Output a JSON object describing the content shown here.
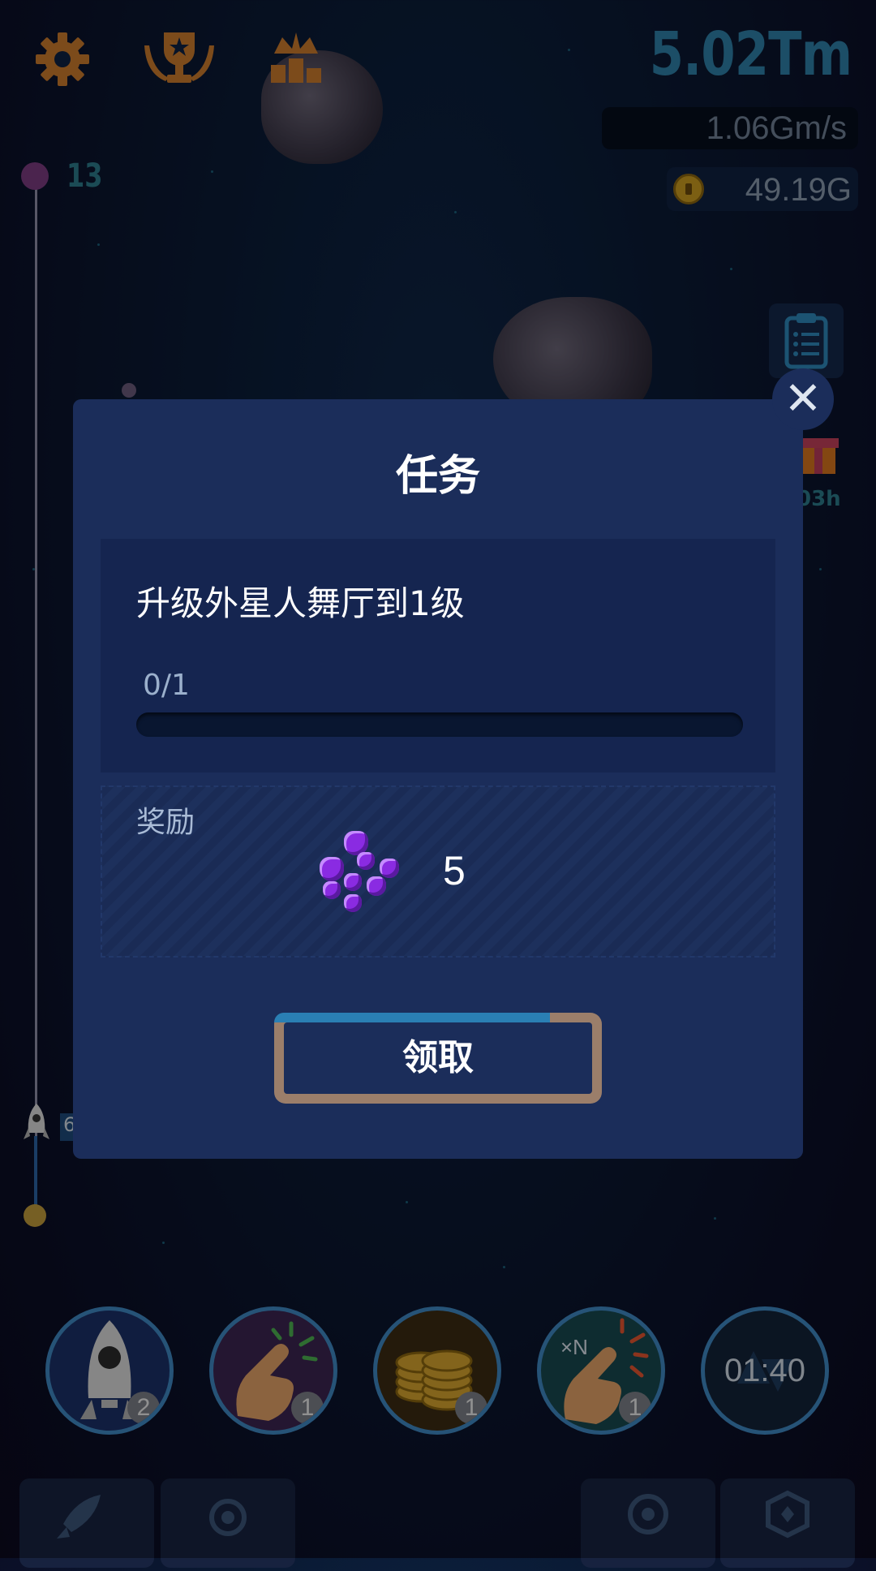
{
  "hud": {
    "distance": "5.02Tm",
    "speed": "1.06Gm/s",
    "coins": "49.19G",
    "icons": [
      "gear-icon",
      "trophy-icon",
      "ranking-crown-icon"
    ]
  },
  "track": {
    "level": "13",
    "rocket_tag": "6"
  },
  "side": {
    "gift_timer": "03h"
  },
  "modal": {
    "title": "任务",
    "task_description": "升级外星人舞厅到1级",
    "task_progress": "0/1",
    "progress_fraction": 0,
    "reward_label": "奖励",
    "reward_icon": "purple-gems-icon",
    "reward_amount": "5",
    "claim_label": "领取",
    "close_icon": "close-icon"
  },
  "boosts": [
    {
      "icon": "rocket-icon",
      "count": "2"
    },
    {
      "icon": "tap-icon",
      "count": "1"
    },
    {
      "icon": "coin-stack-icon",
      "count": "1"
    },
    {
      "icon": "tap-multiplier-icon",
      "label": "×N",
      "count": "1"
    },
    {
      "icon": "speed-arrows-icon",
      "timer": "01:40"
    }
  ],
  "nav": [
    "rocket-nav-icon",
    "gear-module-icon",
    "radar-icon",
    "settings-badge-icon"
  ],
  "colors": {
    "modal_bg": "#1b2d5a",
    "accent_teal": "#2e7fa6",
    "boost_ring": "#3e86c0",
    "claim_border": "#9b7e6a"
  }
}
